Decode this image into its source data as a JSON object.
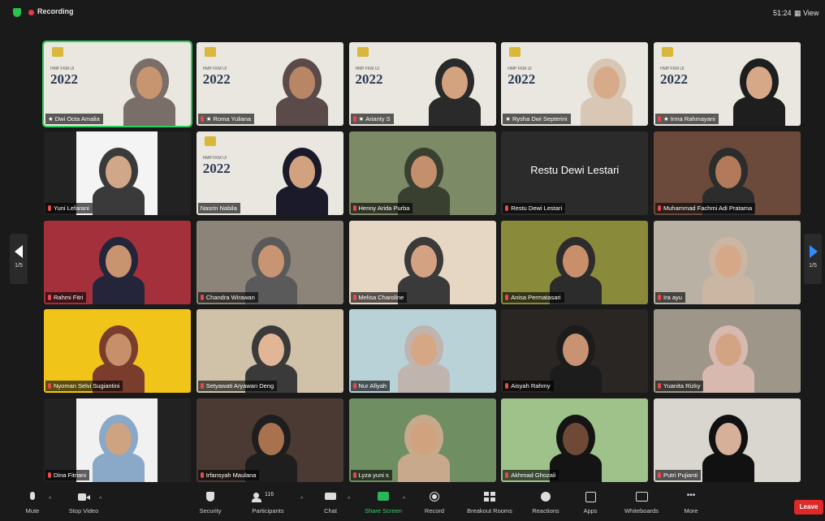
{
  "topbar": {
    "recording": "Recording",
    "timer": "51:24",
    "view": "View"
  },
  "pager": {
    "left": "1/5",
    "right": "1/5"
  },
  "poster": {
    "year": "2022",
    "event": "HMP FKM UI"
  },
  "tiles": [
    {
      "name": "Dwi Octa Amalia",
      "row": 0,
      "col": 0,
      "bg": "#e9e7df",
      "poster": true,
      "active": true,
      "star": true,
      "muted": false,
      "skin": "#c7956f",
      "hijab": "#7a6e68"
    },
    {
      "name": "Roma Yuliana",
      "row": 0,
      "col": 1,
      "bg": "#e9e7df",
      "poster": true,
      "star": true,
      "muted": true,
      "skin": "#b98665",
      "hijab": "#5a4a4a"
    },
    {
      "name": "Arianty S",
      "row": 0,
      "col": 2,
      "bg": "#e9e7df",
      "poster": true,
      "star": true,
      "muted": true,
      "skin": "#d3a27f",
      "hijab": "#2a2a2a"
    },
    {
      "name": "Rysha Dwi Septerini",
      "row": 0,
      "col": 3,
      "bg": "#e9e7df",
      "poster": true,
      "star": true,
      "muted": false,
      "skin": "#d7ab8a",
      "hijab": "#d8c7b4"
    },
    {
      "name": "Irma Rahmayani",
      "row": 0,
      "col": 4,
      "bg": "#e9e7df",
      "poster": true,
      "star": true,
      "muted": true,
      "skin": "#d6a887",
      "hijab": "#1e1e1e"
    },
    {
      "name": "Yuni Lefarani",
      "row": 1,
      "col": 0,
      "bg": "#222222",
      "panel": "#f4f4f4",
      "muted": true,
      "skin": "#d0a788",
      "hijab": "#3a3a3a"
    },
    {
      "name": "Nasrin Nabila",
      "row": 1,
      "col": 1,
      "bg": "#e9e7df",
      "poster": true,
      "muted": false,
      "skin": "#d2a180",
      "hijab": "#1a1a2a"
    },
    {
      "name": "Henny Arida Purba",
      "row": 1,
      "col": 2,
      "bg": "#7d8a66",
      "muted": true,
      "skin": "#c48f6d",
      "hijab": "#394030"
    },
    {
      "name": "Restu Dewi Lestari",
      "row": 1,
      "col": 3,
      "bg": "#2b2b2b",
      "bigname": true,
      "muted": true
    },
    {
      "name": "Muhammad Fachmi Adi Pratama",
      "row": 1,
      "col": 4,
      "bg": "#6b4a3c",
      "muted": true,
      "skin": "#b27a5a",
      "hijab": "#2c2c2c"
    },
    {
      "name": "Rahmi Fitri",
      "row": 2,
      "col": 0,
      "bg": "#a3303a",
      "muted": true,
      "skin": "#c8946f",
      "hijab": "#24243a"
    },
    {
      "name": "Chandra Wirawan",
      "row": 2,
      "col": 1,
      "bg": "#8c8479",
      "muted": true,
      "skin": "#c89574",
      "hijab": "#5a5a5a"
    },
    {
      "name": "Melisa Charoline",
      "row": 2,
      "col": 2,
      "bg": "#e6d6c4",
      "muted": true,
      "skin": "#d3a282",
      "hijab": "#3a3a3a"
    },
    {
      "name": "Anisa Permatasari",
      "row": 2,
      "col": 3,
      "bg": "#8a8b3a",
      "muted": true,
      "skin": "#c98f6b",
      "hijab": "#2c2c2c"
    },
    {
      "name": "Ira ayu",
      "row": 2,
      "col": 4,
      "bg": "#b9b2a4",
      "muted": true,
      "skin": "#d7a888",
      "hijab": "#cbb6a3"
    },
    {
      "name": "Nyoman Selvi Sugiantini",
      "row": 3,
      "col": 0,
      "bg": "#f0c419",
      "muted": true,
      "skin": "#c7906a",
      "hijab": "#7a3c2c"
    },
    {
      "name": "Setyawati Aryawan Deng",
      "row": 3,
      "col": 1,
      "bg": "#cfc2a8",
      "muted": true,
      "skin": "#e0b696",
      "hijab": "#3a3a3a"
    },
    {
      "name": "Nur Afiyah",
      "row": 3,
      "col": 2,
      "bg": "#b8d2d8",
      "muted": true,
      "skin": "#d6a784",
      "hijab": "#bfb5ae"
    },
    {
      "name": "Aisyah Rahmy",
      "row": 3,
      "col": 3,
      "bg": "#2a2624",
      "muted": true,
      "skin": "#c89273",
      "hijab": "#1c1c1c"
    },
    {
      "name": "Yuanita Rizky",
      "row": 3,
      "col": 4,
      "bg": "#9f968a",
      "muted": true,
      "skin": "#d3a484",
      "hijab": "#d7b9b0"
    },
    {
      "name": "Dina Fitriani",
      "row": 4,
      "col": 0,
      "bg": "#222222",
      "panel": "#f1f1f1",
      "muted": true,
      "skin": "#cea381",
      "hijab": "#8aa8c8"
    },
    {
      "name": "Irfansyah Maulana",
      "row": 4,
      "col": 1,
      "bg": "#4b3a34",
      "muted": true,
      "skin": "#a8724f",
      "hijab": "#1e1e1e"
    },
    {
      "name": "Lyza yuni s",
      "row": 4,
      "col": 2,
      "bg": "#6f8e62",
      "muted": true,
      "skin": "#d0a27e",
      "hijab": "#c9a98c"
    },
    {
      "name": "Akhmad Ghozali",
      "row": 4,
      "col": 3,
      "bg": "#9fc28a",
      "muted": true,
      "skin": "#6e4a36",
      "hijab": "#141414"
    },
    {
      "name": "Putri Pujianti",
      "row": 4,
      "col": 4,
      "bg": "#d9d6cf",
      "muted": true,
      "skin": "#d7b09a",
      "hijab": "#111111"
    }
  ],
  "toolbar": {
    "mute": "Mute",
    "stop_video": "Stop Video",
    "security": "Security",
    "participants": "Participants",
    "participants_count": "116",
    "chat": "Chat",
    "share_screen": "Share Screen",
    "record": "Record",
    "breakout_rooms": "Breakout Rooms",
    "reactions": "Reactions",
    "apps": "Apps",
    "whiteboards": "Whiteboards",
    "more": "More",
    "leave": "Leave"
  }
}
